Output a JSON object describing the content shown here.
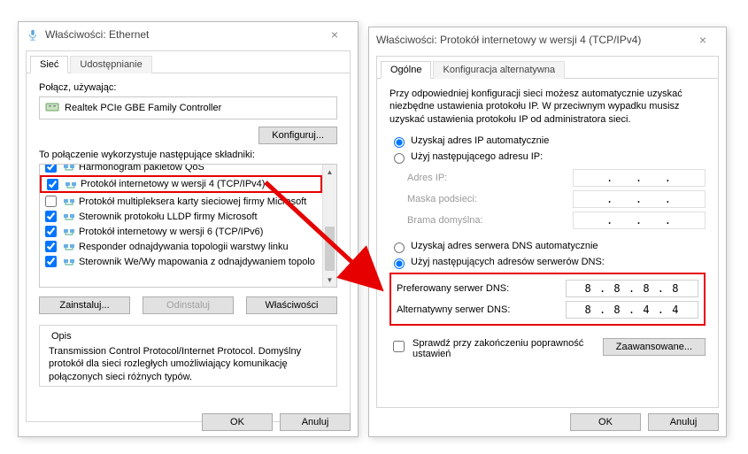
{
  "left": {
    "title": "Właściwości: Ethernet",
    "tabs": {
      "network": "Sieć",
      "sharing": "Udostępnianie"
    },
    "connect_using": "Połącz, używając:",
    "adapter": "Realtek PCIe GBE Family Controller",
    "configure_btn": "Konfiguruj...",
    "components_label": "To połączenie wykorzystuje następujące składniki:",
    "items": [
      "Harmonogram pakietów QoS",
      "Protokół internetowy w wersji 4 (TCP/IPv4)",
      "Protokół multipleksera karty sieciowej firmy Microsoft",
      "Sterownik protokołu LLDP firmy Microsoft",
      "Protokół internetowy w wersji 6 (TCP/IPv6)",
      "Responder odnajdywania topologii warstwy linku",
      "Sterownik We/Wy mapowania z odnajdywaniem topolo"
    ],
    "install_btn": "Zainstaluj...",
    "uninstall_btn": "Odinstaluj",
    "properties_btn": "Właściwości",
    "desc_title": "Opis",
    "desc_text": "Transmission Control Protocol/Internet Protocol. Domyślny protokół dla sieci rozległych umożliwiający komunikację połączonych sieci różnych typów."
  },
  "right": {
    "title": "Właściwości: Protokół internetowy w wersji 4 (TCP/IPv4)",
    "tabs": {
      "general": "Ogólne",
      "alt": "Konfiguracja alternatywna"
    },
    "intro": "Przy odpowiedniej konfiguracji sieci możesz automatycznie uzyskać niezbędne ustawienia protokołu IP. W przeciwnym wypadku musisz uzyskać ustawienia protokołu IP od administratora sieci.",
    "ip_auto": "Uzyskaj adres IP automatycznie",
    "ip_manual": "Użyj następującego adresu IP:",
    "ip_addr": "Adres IP:",
    "mask": "Maska podsieci:",
    "gateway": "Brama domyślna:",
    "dns_auto": "Uzyskaj adres serwera DNS automatycznie",
    "dns_manual": "Użyj następujących adresów serwerów DNS:",
    "pref_dns": "Preferowany serwer DNS:",
    "alt_dns": "Alternatywny serwer DNS:",
    "pref_dns_val": "8 . 8 . 8 . 8",
    "alt_dns_val": "8 . 8 . 4 . 4",
    "validate": "Sprawdź przy zakończeniu poprawność ustawień",
    "advanced_btn": "Zaawansowane..."
  },
  "common": {
    "ok": "OK",
    "cancel": "Anuluj"
  }
}
